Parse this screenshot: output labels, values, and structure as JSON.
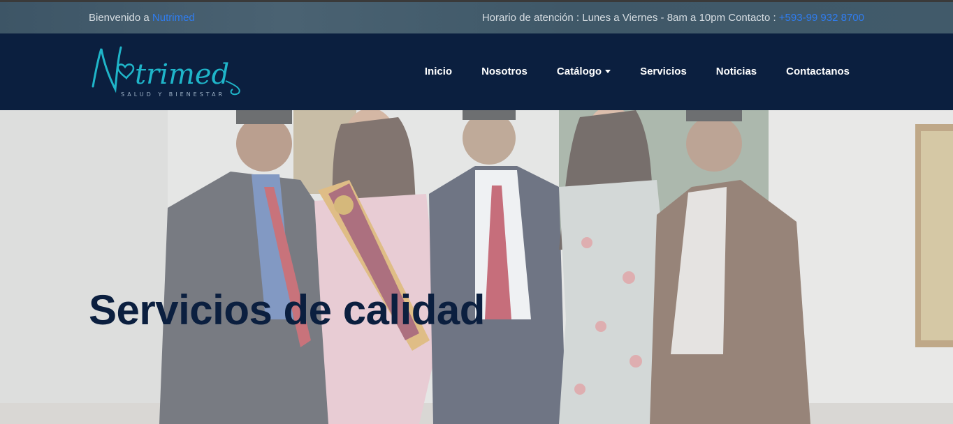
{
  "topbar": {
    "welcome_prefix": "Bienvenido a ",
    "welcome_link": "Nutrimed",
    "hours_text": "Horario de atención : Lunes a Viernes - 8am a 10pm Contacto : ",
    "phone": "+593-99 932 8700"
  },
  "brand": {
    "name": "Nutrimed",
    "tagline": "SALUD Y BIENESTAR",
    "logo_color": "#1fb5c9"
  },
  "nav": {
    "items": [
      {
        "label": "Inicio"
      },
      {
        "label": "Nosotros"
      },
      {
        "label": "Catálogo",
        "dropdown": true
      },
      {
        "label": "Servicios"
      },
      {
        "label": "Noticias"
      },
      {
        "label": "Contactanos"
      }
    ]
  },
  "hero": {
    "heading": "Servicios de calidad"
  },
  "colors": {
    "navy": "#0b1f3f",
    "link_blue": "#2f7df0",
    "topbar": "#4a6272"
  }
}
